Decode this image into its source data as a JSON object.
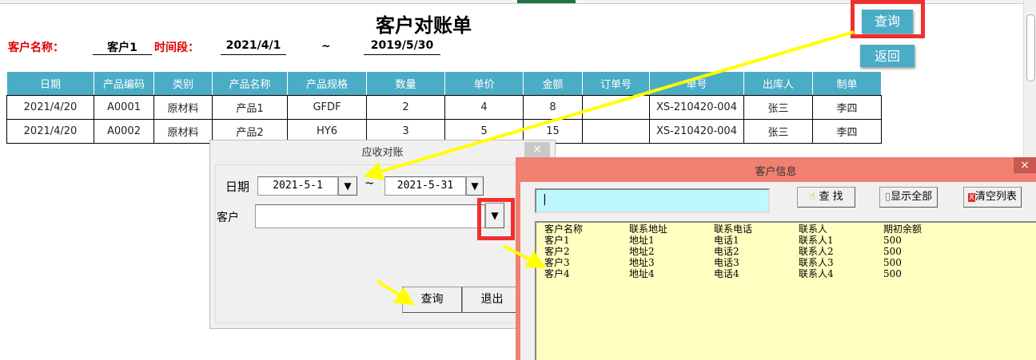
{
  "sheet": {
    "title": "客户对账单",
    "customer_label": "客户名称：",
    "customer_value": "客户1",
    "period_label": "时间段：",
    "start_date": "2021/4/1",
    "tilde": "~",
    "end_date": "2019/5/30",
    "query_button": "查询",
    "back_button": "返回",
    "columns": [
      "日期",
      "产品编码",
      "类别",
      "产品名称",
      "产品规格",
      "数量",
      "单价",
      "金额",
      "订单号",
      "单号",
      "出库人",
      "制单"
    ],
    "rows": [
      [
        "2021/4/20",
        "A0001",
        "原材料",
        "产品1",
        "GFDF",
        "2",
        "4",
        "8",
        "",
        "XS-210420-004",
        "张三",
        "李四"
      ],
      [
        "2021/4/20",
        "A0002",
        "原材料",
        "产品2",
        "HY6",
        "3",
        "5",
        "15",
        "",
        "XS-210420-004",
        "张三",
        "李四"
      ]
    ]
  },
  "dialog_recon": {
    "title": "应收对账",
    "close": "×",
    "date_label": "日期",
    "date_from": "2021-5-1",
    "tilde": "~",
    "date_to": "2021-5-31",
    "customer_label": "客户",
    "customer_value": "",
    "dropdown_glyph": "▼",
    "query_button": "查询",
    "exit_button": "退出"
  },
  "dialog_customer": {
    "title": "客户信息",
    "close": "×",
    "search_value": "|",
    "find_button": "查  找",
    "show_all_button": "显示全部",
    "clear_button": "清空列表",
    "columns": [
      "客户名称",
      "联系地址",
      "联系电话",
      "联系人",
      "期初余额"
    ],
    "rows": [
      [
        "客户1",
        "地址1",
        "电话1",
        "联系人1",
        "500"
      ],
      [
        "客户2",
        "地址2",
        "电话2",
        "联系人2",
        "500"
      ],
      [
        "客户3",
        "地址3",
        "电话3",
        "联系人3",
        "500"
      ],
      [
        "客户4",
        "地址4",
        "电话4",
        "联系人4",
        "500"
      ]
    ]
  },
  "colors": {
    "accent": "#4bacc6",
    "highlight": "#f03030",
    "arrow": "#ffff00",
    "dialog_title": "#f08070",
    "list_bg": "#ffffc0"
  }
}
